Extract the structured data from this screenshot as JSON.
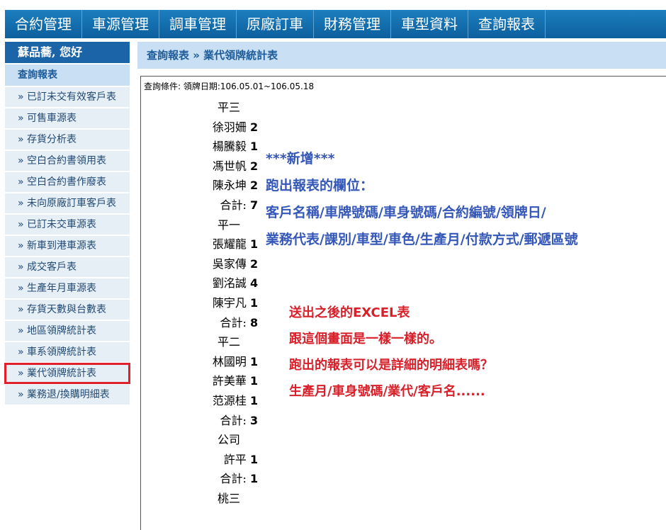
{
  "topnav": {
    "items": [
      "合約管理",
      "車源管理",
      "調車管理",
      "原廠訂車",
      "財務管理",
      "車型資料",
      "查詢報表"
    ]
  },
  "sidebar": {
    "welcome": "蘇品蕎, 您好",
    "section": "查詢報表",
    "items": [
      "» 已訂未交有效客戶表",
      "» 可售車源表",
      "» 存貨分析表",
      "» 空白合約書領用表",
      "» 空白合約書作廢表",
      "» 未向原廠訂車客戶表",
      "» 已訂未交車源表",
      "» 新車到港車源表",
      "» 成交客戶表",
      "» 生產年月車源表",
      "» 存貨天數與台數表",
      "» 地區領牌統計表",
      "» 車系領牌統計表",
      "» 業代領牌統計表",
      "» 業務退/換購明細表"
    ],
    "highlighted_index": 13
  },
  "breadcrumb": "查詢報表 » 業代領牌統計表",
  "query_condition": "查詢條件: 領牌日期:106.05.01~106.05.18",
  "report_rows": [
    {
      "name": "平三",
      "count": ""
    },
    {
      "name": "徐羽姍",
      "count": "2"
    },
    {
      "name": "楊騰毅",
      "count": "1"
    },
    {
      "name": "馮世帆",
      "count": "2"
    },
    {
      "name": "陳永坤",
      "count": "2"
    },
    {
      "name": "合計:",
      "count": "7"
    },
    {
      "name": "平一",
      "count": ""
    },
    {
      "name": "張耀龍",
      "count": "1"
    },
    {
      "name": "吳家傳",
      "count": "2"
    },
    {
      "name": "劉洺誠",
      "count": "4"
    },
    {
      "name": "陳宇凡",
      "count": "1"
    },
    {
      "name": "合計:",
      "count": "8"
    },
    {
      "name": "平二",
      "count": ""
    },
    {
      "name": "林國明",
      "count": "1"
    },
    {
      "name": "許美華",
      "count": "1"
    },
    {
      "name": "范源桂",
      "count": "1"
    },
    {
      "name": "合計:",
      "count": "3"
    },
    {
      "name": "公司",
      "count": ""
    },
    {
      "name": "許平",
      "count": "1"
    },
    {
      "name": "合計:",
      "count": "1"
    },
    {
      "name": "桃三",
      "count": ""
    }
  ],
  "annotation_blue": [
    "***新增***",
    "跑出報表的欄位：",
    "客戶名稱/車牌號碼/車身號碼/合約編號/領牌日/",
    "業務代表/課別/車型/車色/生產月/付款方式/郵遞區號"
  ],
  "annotation_red": [
    "送出之後的EXCEL表",
    "跟這個畫面是一樣一樣的。",
    "跑出的報表可以是詳細的明細表嗎？",
    "生產月/車身號碼/業代/客戶名......"
  ],
  "colors": {
    "nav_blue": "#1c7fbf",
    "panel_light_blue": "#c9dff3",
    "annotation_blue": "#3457b8",
    "annotation_red": "#d8202a",
    "highlight_box": "#e0202a"
  }
}
